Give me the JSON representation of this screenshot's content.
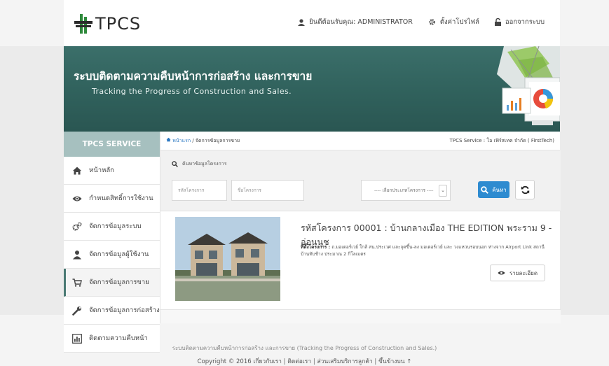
{
  "app": {
    "logo_text": "TPCS",
    "colors": {
      "banner": "#30615c",
      "sidebar_head": "#a6c0bf",
      "primary_button": "#2e8bd0"
    }
  },
  "userbar": {
    "welcome": "ยินดีต้อนรับคุณ: ADMINISTRATOR",
    "profile": "ตั้งค่าโปรไฟล์",
    "logout": "ออกจากระบบ"
  },
  "banner": {
    "title_th": "ระบบติดตามความคืบหน้าการก่อสร้าง และการขาย",
    "title_en": "Tracking the Progress of Construction and Sales."
  },
  "sidebar": {
    "header": "TPCS SERVICE",
    "items": [
      {
        "label": "หน้าหลัก",
        "icon": "home-icon"
      },
      {
        "label": "กำหนดสิทธิ์การใช้งาน",
        "icon": "eye-icon"
      },
      {
        "label": "จัดการข้อมูลระบบ",
        "icon": "gears-icon"
      },
      {
        "label": "จัดการข้อมูลผู้ใช้งาน",
        "icon": "user-icon"
      },
      {
        "label": "จัดการข้อมูลการขาย",
        "icon": "cart-icon",
        "active": true
      },
      {
        "label": "จัดการข้อมูลการก่อสร้าง",
        "icon": "wrench-icon"
      },
      {
        "label": "ติดตามความคืบหน้า",
        "icon": "bar-chart-icon"
      }
    ]
  },
  "breadcrumb": {
    "home": "หน้าแรก",
    "separator": "/",
    "current": "จัดการข้อมูลการขาย",
    "service_info": "TPCS Service : โอ เฟิร์สเทค จำกัด ( FirstTech)"
  },
  "search": {
    "title": "ค้นหาข้อมูลโครงการ",
    "code_placeholder": "รหัสโครงการ",
    "name_placeholder": "ชื่อโครงการ",
    "type_selected": "---- เลือกประเภทโครงการ ----",
    "search_button": "ค้นหา"
  },
  "project": {
    "title": "รหัสโครงการ 00001 : บ้านกลางเมือง THE EDITION พระราม 9 - อ่อนนุช",
    "location_label": "ที่ตั้งโครงการ :",
    "location_text": "ถ.มอเตอร์เวย์ ใกล้ สน.ประเวศ และจุดขึ้น-ลง มอเตอร์เวย์ และ วงแหวนรอบนอก ห่างจาก Airport Link สถานีบ้านทับช้าง ประมาณ 2 กิโลเมตร",
    "detail_button": "รายละเอียด"
  },
  "footer": {
    "line1": "ระบบติดตามความคืบหน้าการก่อสร้าง และการขาย  (Tracking the Progress of Construction and Sales.)",
    "copyright": "Copyright © 2016",
    "links": [
      "เกี่ยวกับเรา",
      "ติดต่อเรา",
      "ส่วนเสริมบริการลูกค้า",
      "ขึ้นข้างบน ↑"
    ]
  }
}
